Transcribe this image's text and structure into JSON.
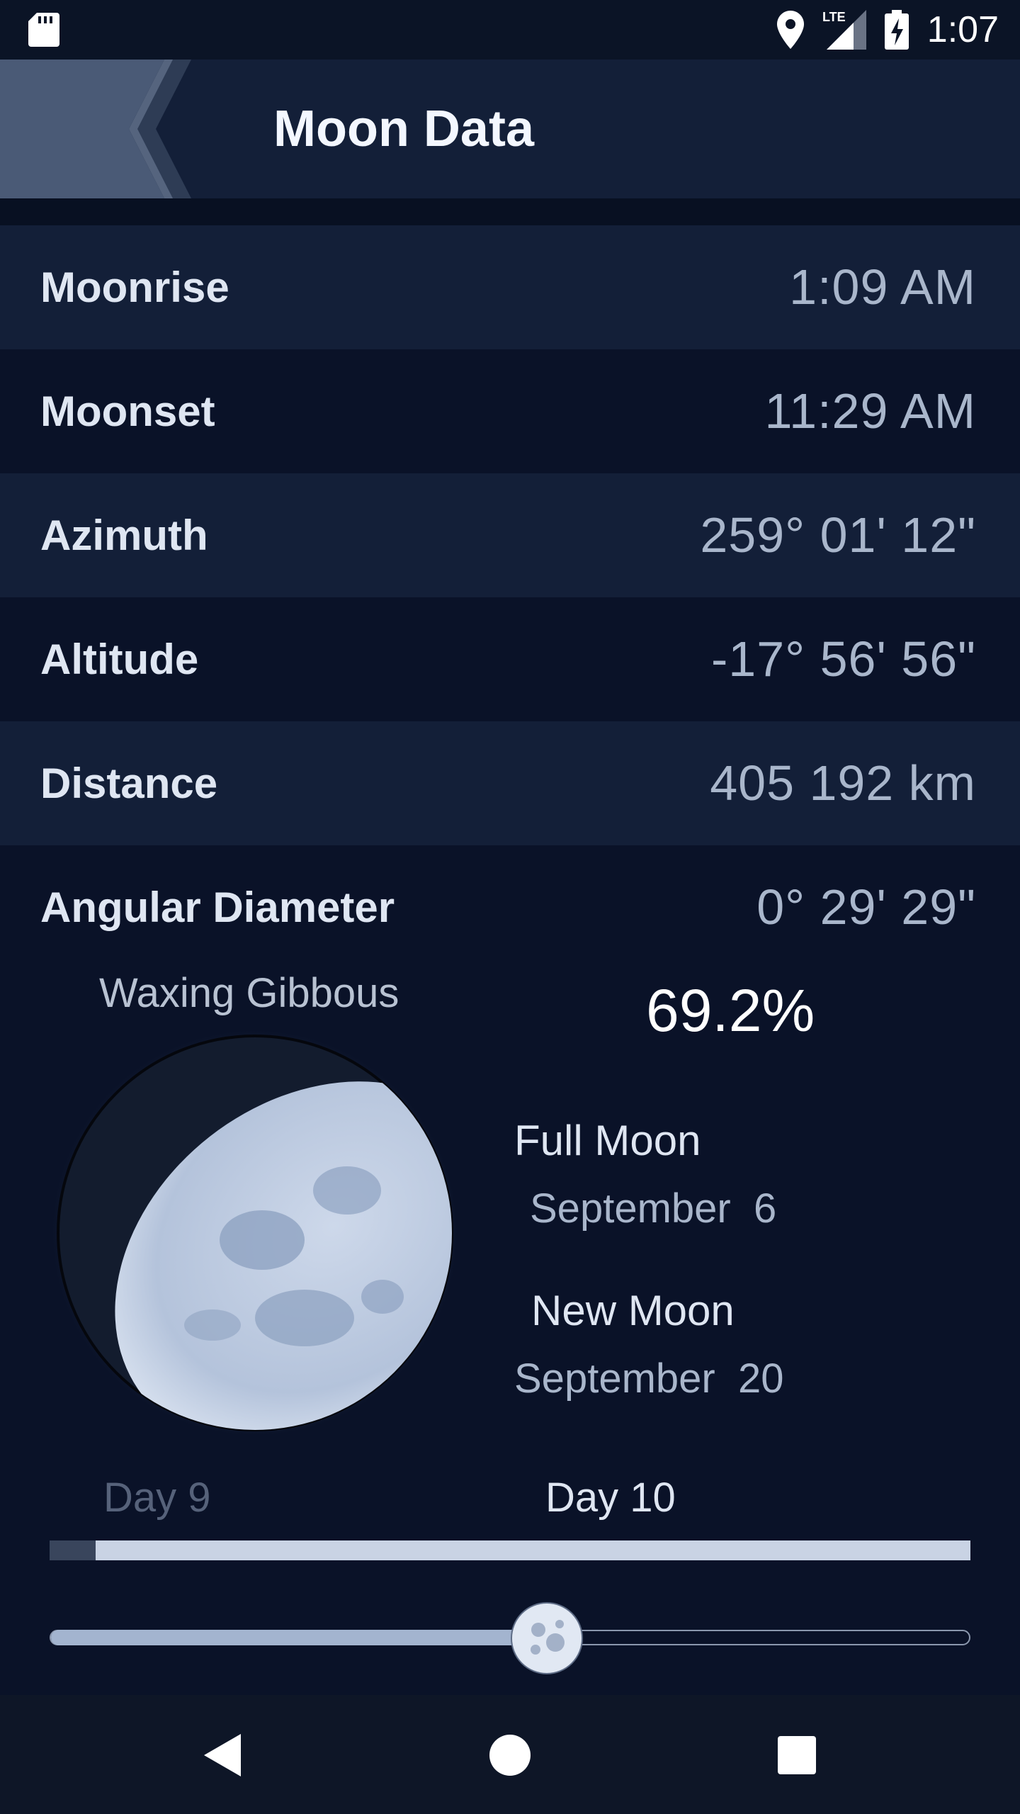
{
  "status_bar": {
    "time": "1:07",
    "network_label": "LTE",
    "icons": [
      "sd-card-icon",
      "location-icon",
      "lte-signal-icon",
      "battery-charging-icon"
    ]
  },
  "app_bar": {
    "title": "Moon Data",
    "back_icon": "back-chevron-icon"
  },
  "rows": [
    {
      "label": "Moonrise",
      "value": "1:09 AM"
    },
    {
      "label": "Moonset",
      "value": "11:29 AM"
    },
    {
      "label": "Azimuth",
      "value": "259° 01' 12\""
    },
    {
      "label": "Altitude",
      "value": "-17° 56' 56\""
    },
    {
      "label": "Distance",
      "value": "405 192 km"
    },
    {
      "label": "Angular Diameter",
      "value": "0° 29' 29\""
    }
  ],
  "moon": {
    "phase_name": "Waxing Gibbous",
    "illumination": "69.2%",
    "full_moon_label": "Full Moon",
    "full_moon_date": "September  6",
    "new_moon_label": "New Moon",
    "new_moon_date": "September  20"
  },
  "days": {
    "previous": "Day 9",
    "current": "Day 10",
    "progress_fraction": 0.95
  },
  "slider": {
    "position_fraction": 0.54
  },
  "nav_bar": {
    "icons": [
      "back-triangle-icon",
      "home-circle-icon",
      "recents-square-icon"
    ]
  },
  "colors": {
    "background": "#0a1228",
    "row_alt": "#131f38",
    "accent": "#a3b4cf"
  }
}
